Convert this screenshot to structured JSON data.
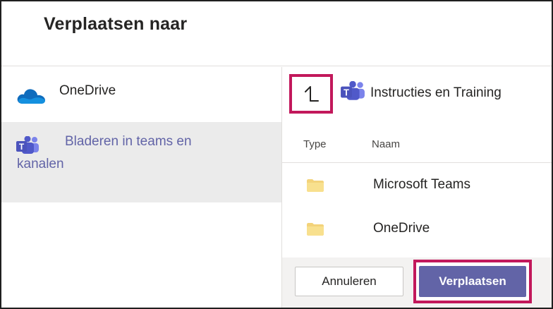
{
  "dialog": {
    "title": "Verplaatsen naar"
  },
  "sidebar": {
    "items": [
      {
        "label": "OneDrive",
        "icon": "onedrive-icon",
        "selected": false
      },
      {
        "label_line1": "Bladeren in teams en",
        "label_line2": "kanalen",
        "icon": "teams-icon",
        "selected": true
      }
    ]
  },
  "content": {
    "up_icon": "arrow-up-icon",
    "breadcrumb": {
      "icon": "teams-icon",
      "label": "Instructies en Training"
    },
    "columns": {
      "type": "Type",
      "name": "Naam"
    },
    "files": [
      {
        "type_icon": "folder-icon",
        "name": "Microsoft Teams"
      },
      {
        "type_icon": "folder-icon",
        "name": "OneDrive"
      }
    ]
  },
  "footer": {
    "cancel_label": "Annuleren",
    "move_label": "Verplaatsen"
  },
  "colors": {
    "accent": "#6264a7",
    "highlight_border": "#c2185b",
    "selected_bg": "#ebebeb",
    "folder": "#f3d37a",
    "onedrive_blue": "#0f6cbd"
  }
}
